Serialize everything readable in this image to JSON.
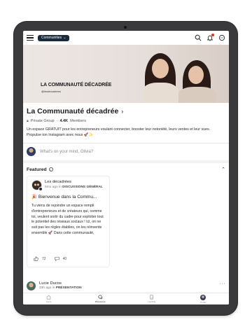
{
  "topbar": {
    "communities_label": "Communities"
  },
  "banner": {
    "title": "LA COMMUNAUTÉ DÉCADRÉE",
    "handle": "@lesdecadrees"
  },
  "community": {
    "name": "La Communauté décadrée",
    "privacy": "Private Group",
    "members_count": "4.4K",
    "members_label": "Members",
    "description": "Un espace GRATUIT pour les entrepreneurs voulant connecter, booster leur notoriété, leurs ventes et leur vues. Propulse ton Instagram avec nous 🚀✨"
  },
  "composer": {
    "placeholder": "What's on your mind, Olivia?"
  },
  "featured": {
    "title": "Featured",
    "post": {
      "author": "Les décadrées",
      "time": "5mo ago in",
      "space": "DISCUSSIONS GÉNÉRAL",
      "title": "🎉 Bienvenue dans la Commu...",
      "body": "Tu viens de rejoindre un espace rempli d'entrepreneurs et de créateurs qui, comme toi, veulent sortir du cadre pour exploiter tout le potentiel des réseaux sociaux ! Ici, on ne suit pas les règles établies, on les réinvente ensemble 🚀 Dans cette communauté,",
      "likes": "72",
      "comments": "40"
    }
  },
  "next_post": {
    "author": "Lucie Ducos",
    "time": "23h ago in",
    "space": "PRÉSENTATION"
  },
  "bottom_nav": {
    "items": [
      {
        "label": "Home"
      },
      {
        "label": "Discussions"
      },
      {
        "label": "Learning"
      },
      {
        "label": "Profile"
      }
    ],
    "active_index": 1
  },
  "colors": {
    "brand_dark": "#1a2b3c",
    "notification": "#e0332b",
    "banner_bg": "#ede7e3"
  }
}
